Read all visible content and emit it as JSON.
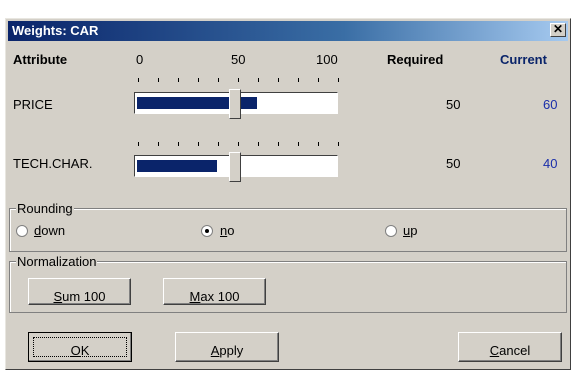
{
  "window": {
    "title": "Weights: CAR",
    "close_label": "✕"
  },
  "header": {
    "attribute": "Attribute",
    "scale_min": "0",
    "scale_mid": "50",
    "scale_max": "100",
    "required": "Required",
    "current": "Current"
  },
  "rows": [
    {
      "label": "PRICE",
      "required": "50",
      "current": "60",
      "slider_value": 50,
      "current_fill": 60
    },
    {
      "label": "TECH.CHAR.",
      "required": "50",
      "current": "40",
      "slider_value": 50,
      "current_fill": 40
    }
  ],
  "rounding": {
    "title": "Rounding",
    "options": [
      {
        "label_key": "d",
        "label_rest": "own",
        "checked": false
      },
      {
        "label_key": "n",
        "label_rest": "o",
        "checked": true
      },
      {
        "label_key": "u",
        "label_rest": "p",
        "checked": false
      }
    ]
  },
  "normalization": {
    "title": "Normalization",
    "sum_key": "S",
    "sum_rest": "um 100",
    "max_key": "M",
    "max_rest": "ax 100"
  },
  "buttons": {
    "ok_key": "O",
    "ok_rest": "K",
    "apply_key": "A",
    "apply_rest": "pply",
    "cancel_key": "C",
    "cancel_rest": "ancel"
  },
  "colors": {
    "fill": "#0a246a",
    "current_text": "#1a2eaa",
    "face": "#d4d0c8"
  }
}
